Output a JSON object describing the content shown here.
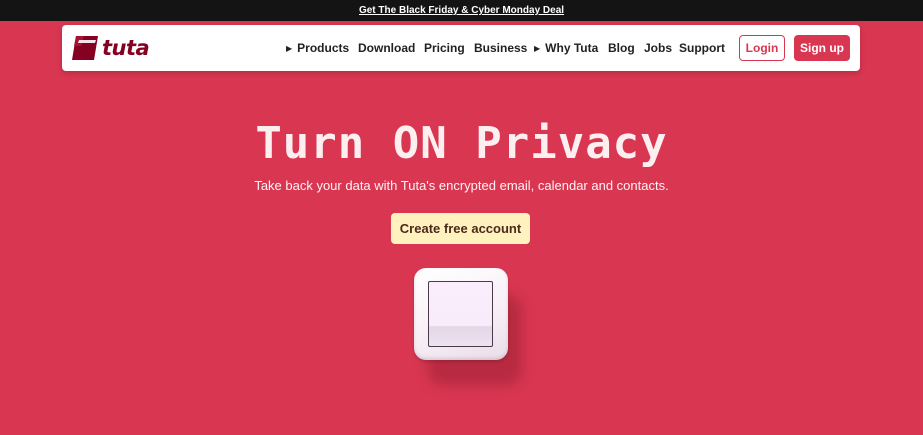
{
  "promo": {
    "text": "Get The Black Friday & Cyber Monday Deal"
  },
  "brand": {
    "logo_text": "tuta"
  },
  "nav": {
    "products": "Products",
    "download": "Download",
    "pricing": "Pricing",
    "business": "Business",
    "why_tuta": "Why Tuta",
    "blog": "Blog",
    "jobs": "Jobs",
    "support": "Support",
    "login": "Login",
    "signup": "Sign up"
  },
  "hero": {
    "title": "Turn ON Privacy",
    "subtitle": "Take back your data with Tuta's encrypted email, calendar and contacts.",
    "cta": "Create free account"
  },
  "colors": {
    "background": "#d93651",
    "promo_bar": "#141414",
    "brand": "#850122",
    "cta_background": "#fff2bf"
  },
  "icons": {
    "logo": "tuta-logo-icon",
    "expand": "triangle-right-icon",
    "switch": "light-switch-illustration"
  }
}
